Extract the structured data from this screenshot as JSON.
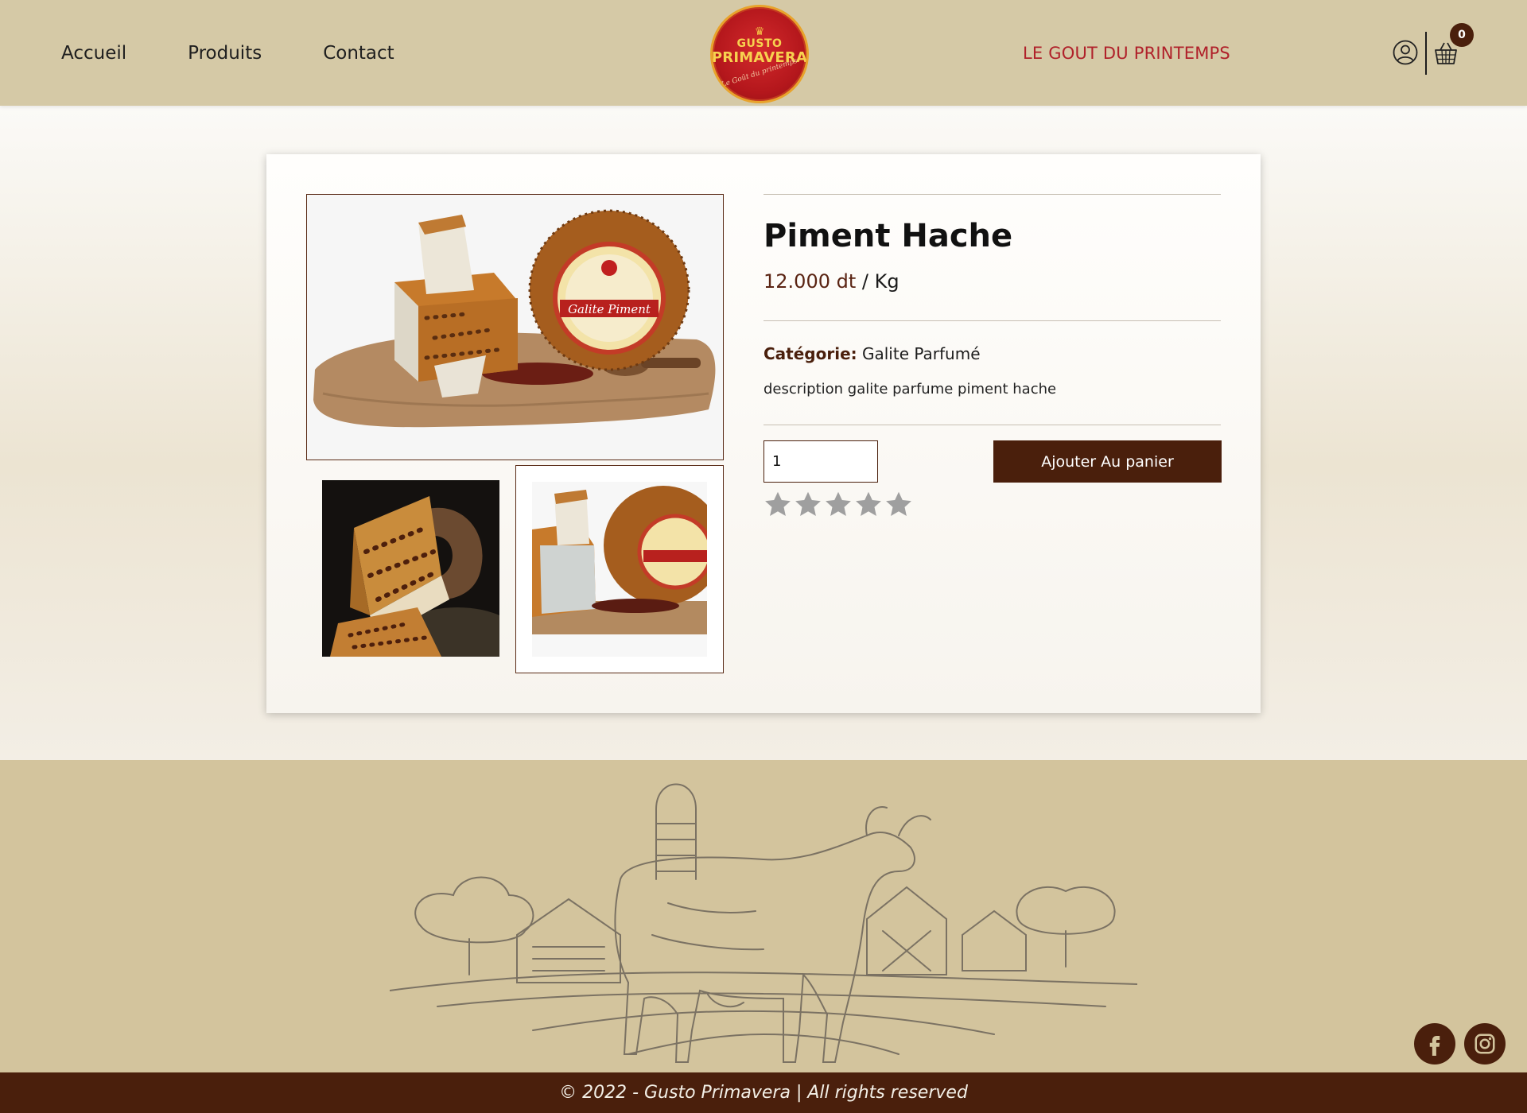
{
  "nav": {
    "items": [
      "Accueil",
      "Produits",
      "Contact"
    ]
  },
  "brand": {
    "logo_line1": "GUSTO",
    "logo_line2": "PRIMAVERA",
    "logo_tagline": "Le Goût du printemps",
    "slogan": "LE GOUT DU PRINTEMPS"
  },
  "cart": {
    "count": "0"
  },
  "product": {
    "title": "Piment Hache",
    "price_amount": "12.000 dt",
    "price_unit": "/ Kg",
    "category_label": "Catégorie:",
    "category_value": "Galite Parfumé",
    "description": "description galite parfume piment hache",
    "quantity": "1",
    "add_button": "Ajouter Au panier",
    "rating": 0,
    "rating_max": 5,
    "image_label": "Galite Piment"
  },
  "footer": {
    "copyright": "© 2022 - Gusto Primavera | All rights reserved",
    "social": [
      "facebook-icon",
      "instagram-icon"
    ]
  },
  "colors": {
    "header_bg": "#d5c9a6",
    "accent_brown": "#4a1f0c",
    "slogan_red": "#b0212a",
    "footer_bg": "#d3c49d"
  }
}
